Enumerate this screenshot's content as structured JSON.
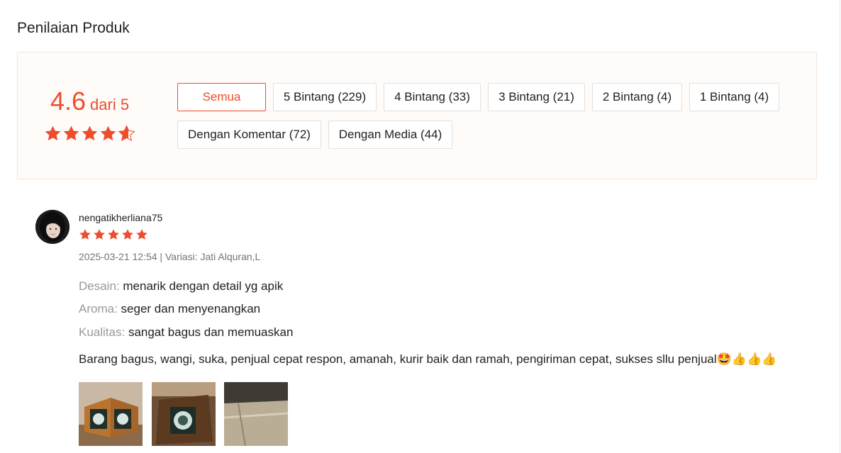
{
  "section": {
    "title": "Penilaian Produk"
  },
  "summary": {
    "score": "4.6",
    "out_of": "dari 5",
    "rating_value": 4.6,
    "rating_max": 5
  },
  "filters": [
    {
      "label": "Semua",
      "active": true
    },
    {
      "label": "5 Bintang (229)"
    },
    {
      "label": "4 Bintang (33)"
    },
    {
      "label": "3 Bintang (21)"
    },
    {
      "label": "2 Bintang (4)"
    },
    {
      "label": "1 Bintang (4)"
    },
    {
      "label": "Dengan Komentar (72)"
    },
    {
      "label": "Dengan Media (44)"
    }
  ],
  "review": {
    "username": "nengatikherliana75",
    "rating": 5,
    "meta": "2025-03-21 12:54 | Variasi: Jati Alquran,L",
    "attributes": [
      {
        "key": "Desain:",
        "value": "menarik dengan detail yg apik"
      },
      {
        "key": "Aroma:",
        "value": "seger dan menyenangkan"
      },
      {
        "key": "Kualitas:",
        "value": "sangat bagus dan memuaskan"
      }
    ],
    "comment": "Barang bagus, wangi, suka, penjual cepat respon, amanah, kurir baik dan ramah, pengiriman cepat, sukses sllu penjual🤩👍👍👍"
  },
  "colors": {
    "accent": "#ee4d2d",
    "panel_bg": "#fffbf8",
    "muted": "#999999"
  }
}
